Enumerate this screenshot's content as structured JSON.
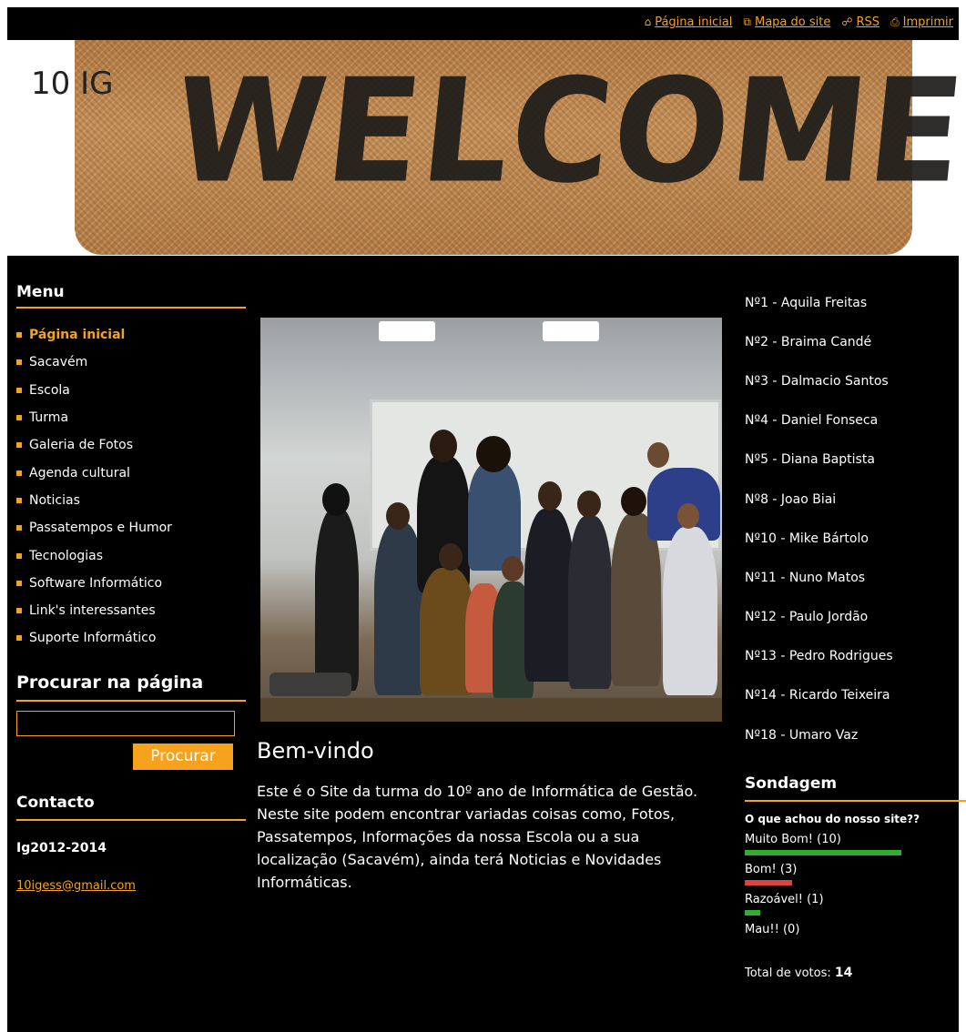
{
  "toplinks": [
    {
      "icon": "home-icon",
      "glyph": "⌂",
      "label": "Página inicial"
    },
    {
      "icon": "sitemap-icon",
      "glyph": "⧉",
      "label": "Mapa do site"
    },
    {
      "icon": "rss-icon",
      "glyph": "☍",
      "label": "RSS"
    },
    {
      "icon": "print-icon",
      "glyph": "⎙",
      "label": "Imprimir"
    }
  ],
  "header": {
    "site_title": "10 IG",
    "banner_text": "WELCOME"
  },
  "menu": {
    "title": "Menu",
    "items": [
      "Página inicial",
      "Sacavém",
      "Escola",
      "Turma",
      "Galeria de Fotos",
      "Agenda cultural",
      "Noticias",
      "Passatempos e Humor",
      "Tecnologias",
      "Software Informático",
      "Link's interessantes",
      "Suporte Informático"
    ]
  },
  "search": {
    "title": "Procurar na página",
    "button": "Procurar",
    "value": ""
  },
  "contact": {
    "title": "Contacto",
    "name": "Ig2012-2014",
    "email": "10igess@gmail.com"
  },
  "content": {
    "title": "Bem-vindo",
    "text": "Este é o Site da turma do 10º ano de Informática de Gestão.\nNeste site podem encontrar variadas coisas como, Fotos, Passatempos, Informações da nossa Escola ou a sua localização (Sacavém), ainda terá Noticias e Novidades Informáticas."
  },
  "students": [
    "Nº1 - Aquila Freitas",
    "Nº2 - Braima Candé",
    "Nº3 - Dalmacio Santos",
    "Nº4 - Daniel Fonseca",
    "Nº5 - Diana Baptista",
    "Nº8 - Joao Biai",
    "Nº10 - Mike Bártolo",
    "Nº11 - Nuno Matos",
    "Nº12 - Paulo Jordão",
    "Nº13 - Pedro Rodrigues",
    "Nº14 - Ricardo Teixeira",
    "Nº18 - Umaro Vaz"
  ],
  "poll": {
    "title": "Sondagem",
    "question": "O que achou do nosso site??",
    "options": [
      {
        "label": "Muito Bom! (10)",
        "votes": 10,
        "color": "#2fae2f"
      },
      {
        "label": "Bom! (3)",
        "votes": 3,
        "color": "#d9453c"
      },
      {
        "label": "Razoável! (1)",
        "votes": 1,
        "color": "#2fae2f"
      },
      {
        "label": "Mau!! (0)",
        "votes": 0,
        "color": "#2fae2f"
      }
    ],
    "total_label": "Total de votos:",
    "total": "14"
  },
  "colors": {
    "accent": "#f6a21d",
    "background": "#000000"
  }
}
